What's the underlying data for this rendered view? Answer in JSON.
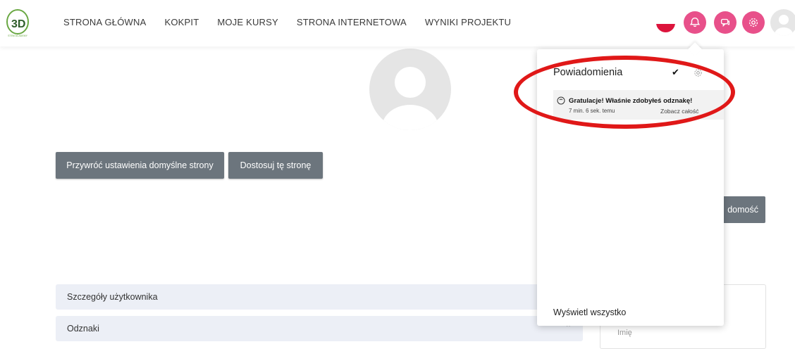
{
  "nav": {
    "logo_text": "STEM ACADEMY",
    "links": [
      "STRONA GŁÓWNA",
      "KOKPIT",
      "MOJE KURSY",
      "STRONA INTERNETOWA",
      "WYNIKI PROJEKTU"
    ]
  },
  "icons": {
    "notifications": "bell-icon",
    "messages": "chat-icon",
    "settings": "gear-icon"
  },
  "colors": {
    "accent": "#e8508a",
    "button": "#6c757d",
    "highlight": "#e01818"
  },
  "profile": {
    "reset_button": "Przywróć ustawienia domyślne strony",
    "customize_button": "Dostosuj tę stronę",
    "message_button": "domość"
  },
  "sections": {
    "user_details": "Szczegóły użytkownika",
    "badges": "Odznaki"
  },
  "side_card": {
    "label": "Imię"
  },
  "notifications": {
    "title": "Powiadomienia",
    "item": {
      "text": "Gratulacje! Właśnie zdobyłeś odznakę!",
      "time": "7 min. 6 sek. temu",
      "view": "Zobacz całość"
    },
    "footer": "Wyświetl wszystko"
  }
}
